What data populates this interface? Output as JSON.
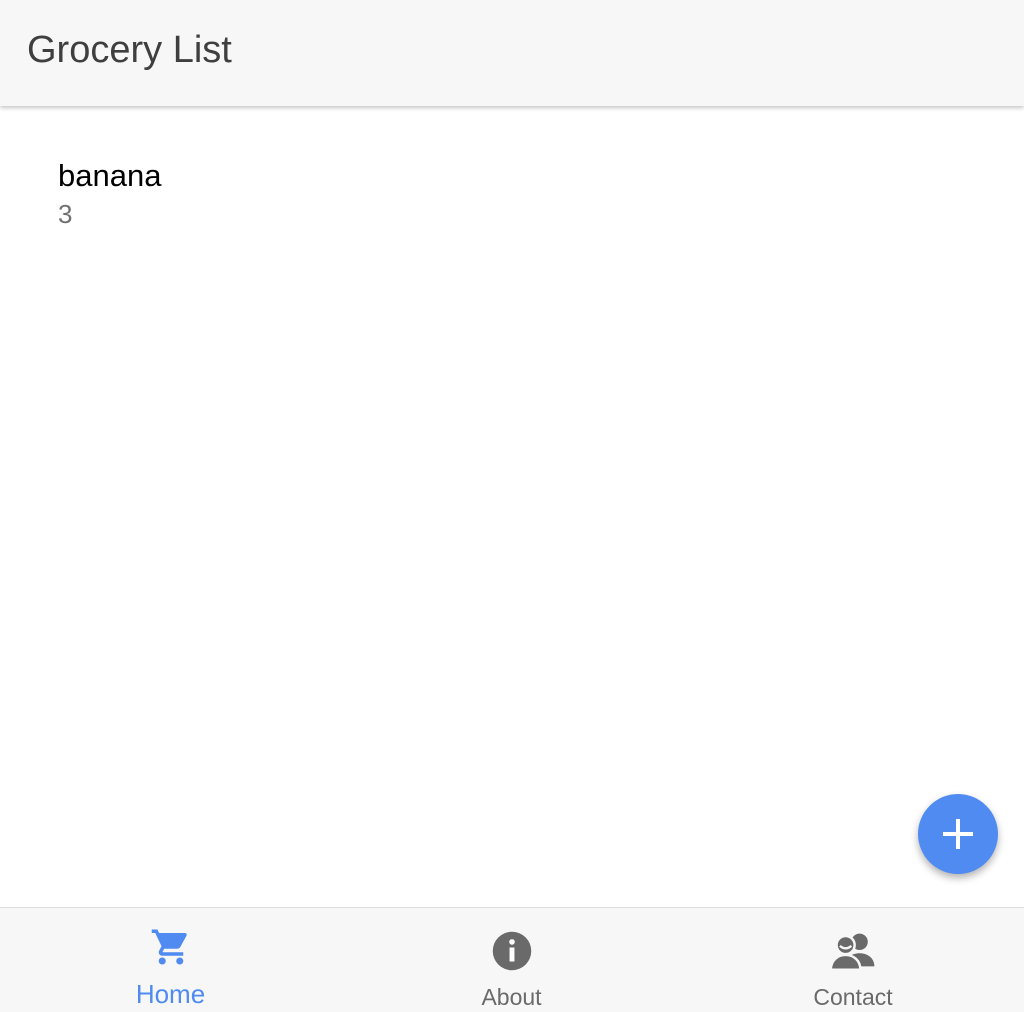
{
  "header": {
    "title": "Grocery List"
  },
  "items": [
    {
      "name": "banana",
      "quantity": "3"
    }
  ],
  "fab": {
    "icon": "plus-icon"
  },
  "bottom_nav": {
    "active": "Home",
    "tabs": [
      {
        "label": "Home",
        "icon": "shopping-cart-icon"
      },
      {
        "label": "About",
        "icon": "info-icon"
      },
      {
        "label": "Contact",
        "icon": "contacts-icon"
      }
    ]
  },
  "colors": {
    "accent": "#4f8bf0",
    "header_bg": "#f7f7f7",
    "inactive": "#6a6a6a"
  }
}
